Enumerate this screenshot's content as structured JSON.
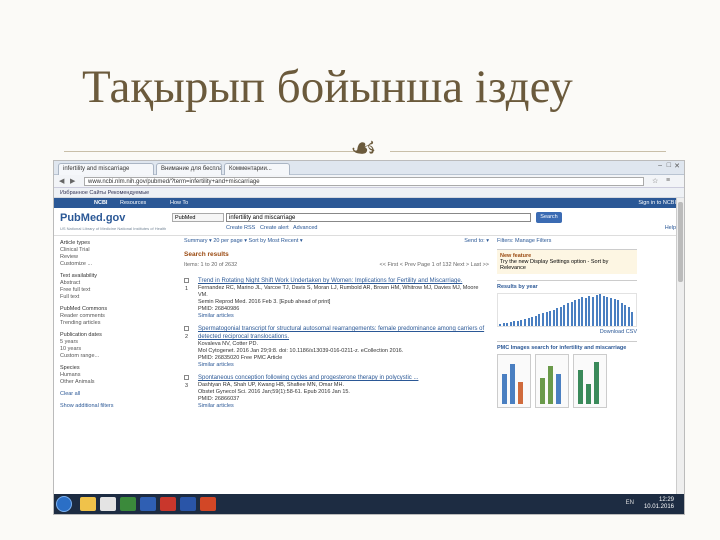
{
  "slide": {
    "title": "Тақырып бойынша іздеу"
  },
  "browser": {
    "tabs": [
      "infertility and miscarriage",
      "Внимание для бесплатн...",
      "Комментарии..."
    ],
    "url": "www.ncbi.nlm.nih.gov/pubmed/?term=infertility+and+miscarriage",
    "bookmarks": "Избранное  Сайты  Рекомендуемые"
  },
  "ncbi": {
    "brand": "NCBI",
    "resources": "Resources",
    "howto": "How To",
    "signin": "Sign in to NCBI"
  },
  "pubmed": {
    "logo": "PubMed.gov",
    "logo_sub": "US National Library of Medicine National Institutes of Health",
    "db": "PubMed",
    "query": "infertility and miscarriage",
    "search_btn": "Search",
    "rss": "Create RSS",
    "alert": "Create alert",
    "advanced": "Advanced",
    "help": "Help"
  },
  "filters": {
    "article_types": [
      "Article types",
      "Clinical Trial",
      "Review",
      "Customize ..."
    ],
    "text": [
      "Text availability",
      "Abstract",
      "Free full text",
      "Full text"
    ],
    "pmc": [
      "PubMed Commons",
      "Reader comments",
      "Trending articles"
    ],
    "dates": [
      "Publication dates",
      "5 years",
      "10 years",
      "Custom range..."
    ],
    "species": [
      "Species",
      "Humans",
      "Other Animals"
    ],
    "clear": "Clear all",
    "more": "Show additional filters"
  },
  "results": {
    "toolbar": "Summary ▾  20 per page ▾  Sort by Most Recent ▾",
    "send": "Send to: ▾",
    "title": "Search results",
    "count": "Items: 1 to 20 of 2632",
    "pager": "<< First  < Prev  Page 1 of 132  Next >  Last >>",
    "items": [
      {
        "n": "1",
        "title": "Trend in Rotating Night Shift Work Undertaken by Women: Implications for Fertility and Miscarriage.",
        "authors": "Fernandez RC, Marino JL, Varcoe TJ, Davis S, Moran LJ, Rumbold AR, Brown HM, Whitrow MJ, Davies MJ, Moore VM.",
        "journal": "Semin Reprod Med. 2016 Feb 3. [Epub ahead of print]",
        "pmid": "PMID: 26840986",
        "sim": "Similar articles"
      },
      {
        "n": "2",
        "title": "Spermatogonial transcript for structural autosomal rearrangements: female predominance among carriers of detected reciprocal translocations.",
        "authors": "Kovaleva NV, Cotter PD.",
        "journal": "Mol Cytogenet. 2016 Jan 29;9:8. doi: 10.1186/s13039-016-0211-z. eCollection 2016.",
        "pmid": "PMID: 26835020  Free PMC Article",
        "sim": "Similar articles"
      },
      {
        "n": "3",
        "title": "Spontaneous conception following cycles and progesterone therapy in polycystic ...",
        "authors": "Dashtyan RA, Shah UP, Kwang HB, Shafiee MN, Omar MH.",
        "journal": "Obstet Gynecol Sci. 2016 Jan;59(1):58-61. Epub 2016 Jan 15.",
        "pmid": "PMID: 26866037",
        "sim": "Similar articles"
      }
    ]
  },
  "sidebar": {
    "filters_title": "Filters: Manage Filters",
    "new_feature": "New feature",
    "new_feature_text": "Try the new Display Settings option - Sort by Relevance",
    "by_year": "Results by year",
    "download": "Download CSV",
    "images": "PMC Images search for infertility and miscarriage"
  },
  "taskbar": {
    "lang": "EN",
    "time": "12:29",
    "date": "10.01.2016"
  },
  "chart_data": {
    "type": "bar",
    "title": "Results by year",
    "values": [
      2,
      3,
      3,
      4,
      5,
      5,
      6,
      7,
      8,
      9,
      10,
      12,
      13,
      14,
      16,
      17,
      19,
      20,
      22,
      24,
      25,
      27,
      28,
      30,
      29,
      31,
      30,
      32,
      33,
      31,
      30,
      29,
      28,
      27,
      24,
      22,
      20,
      14
    ]
  }
}
